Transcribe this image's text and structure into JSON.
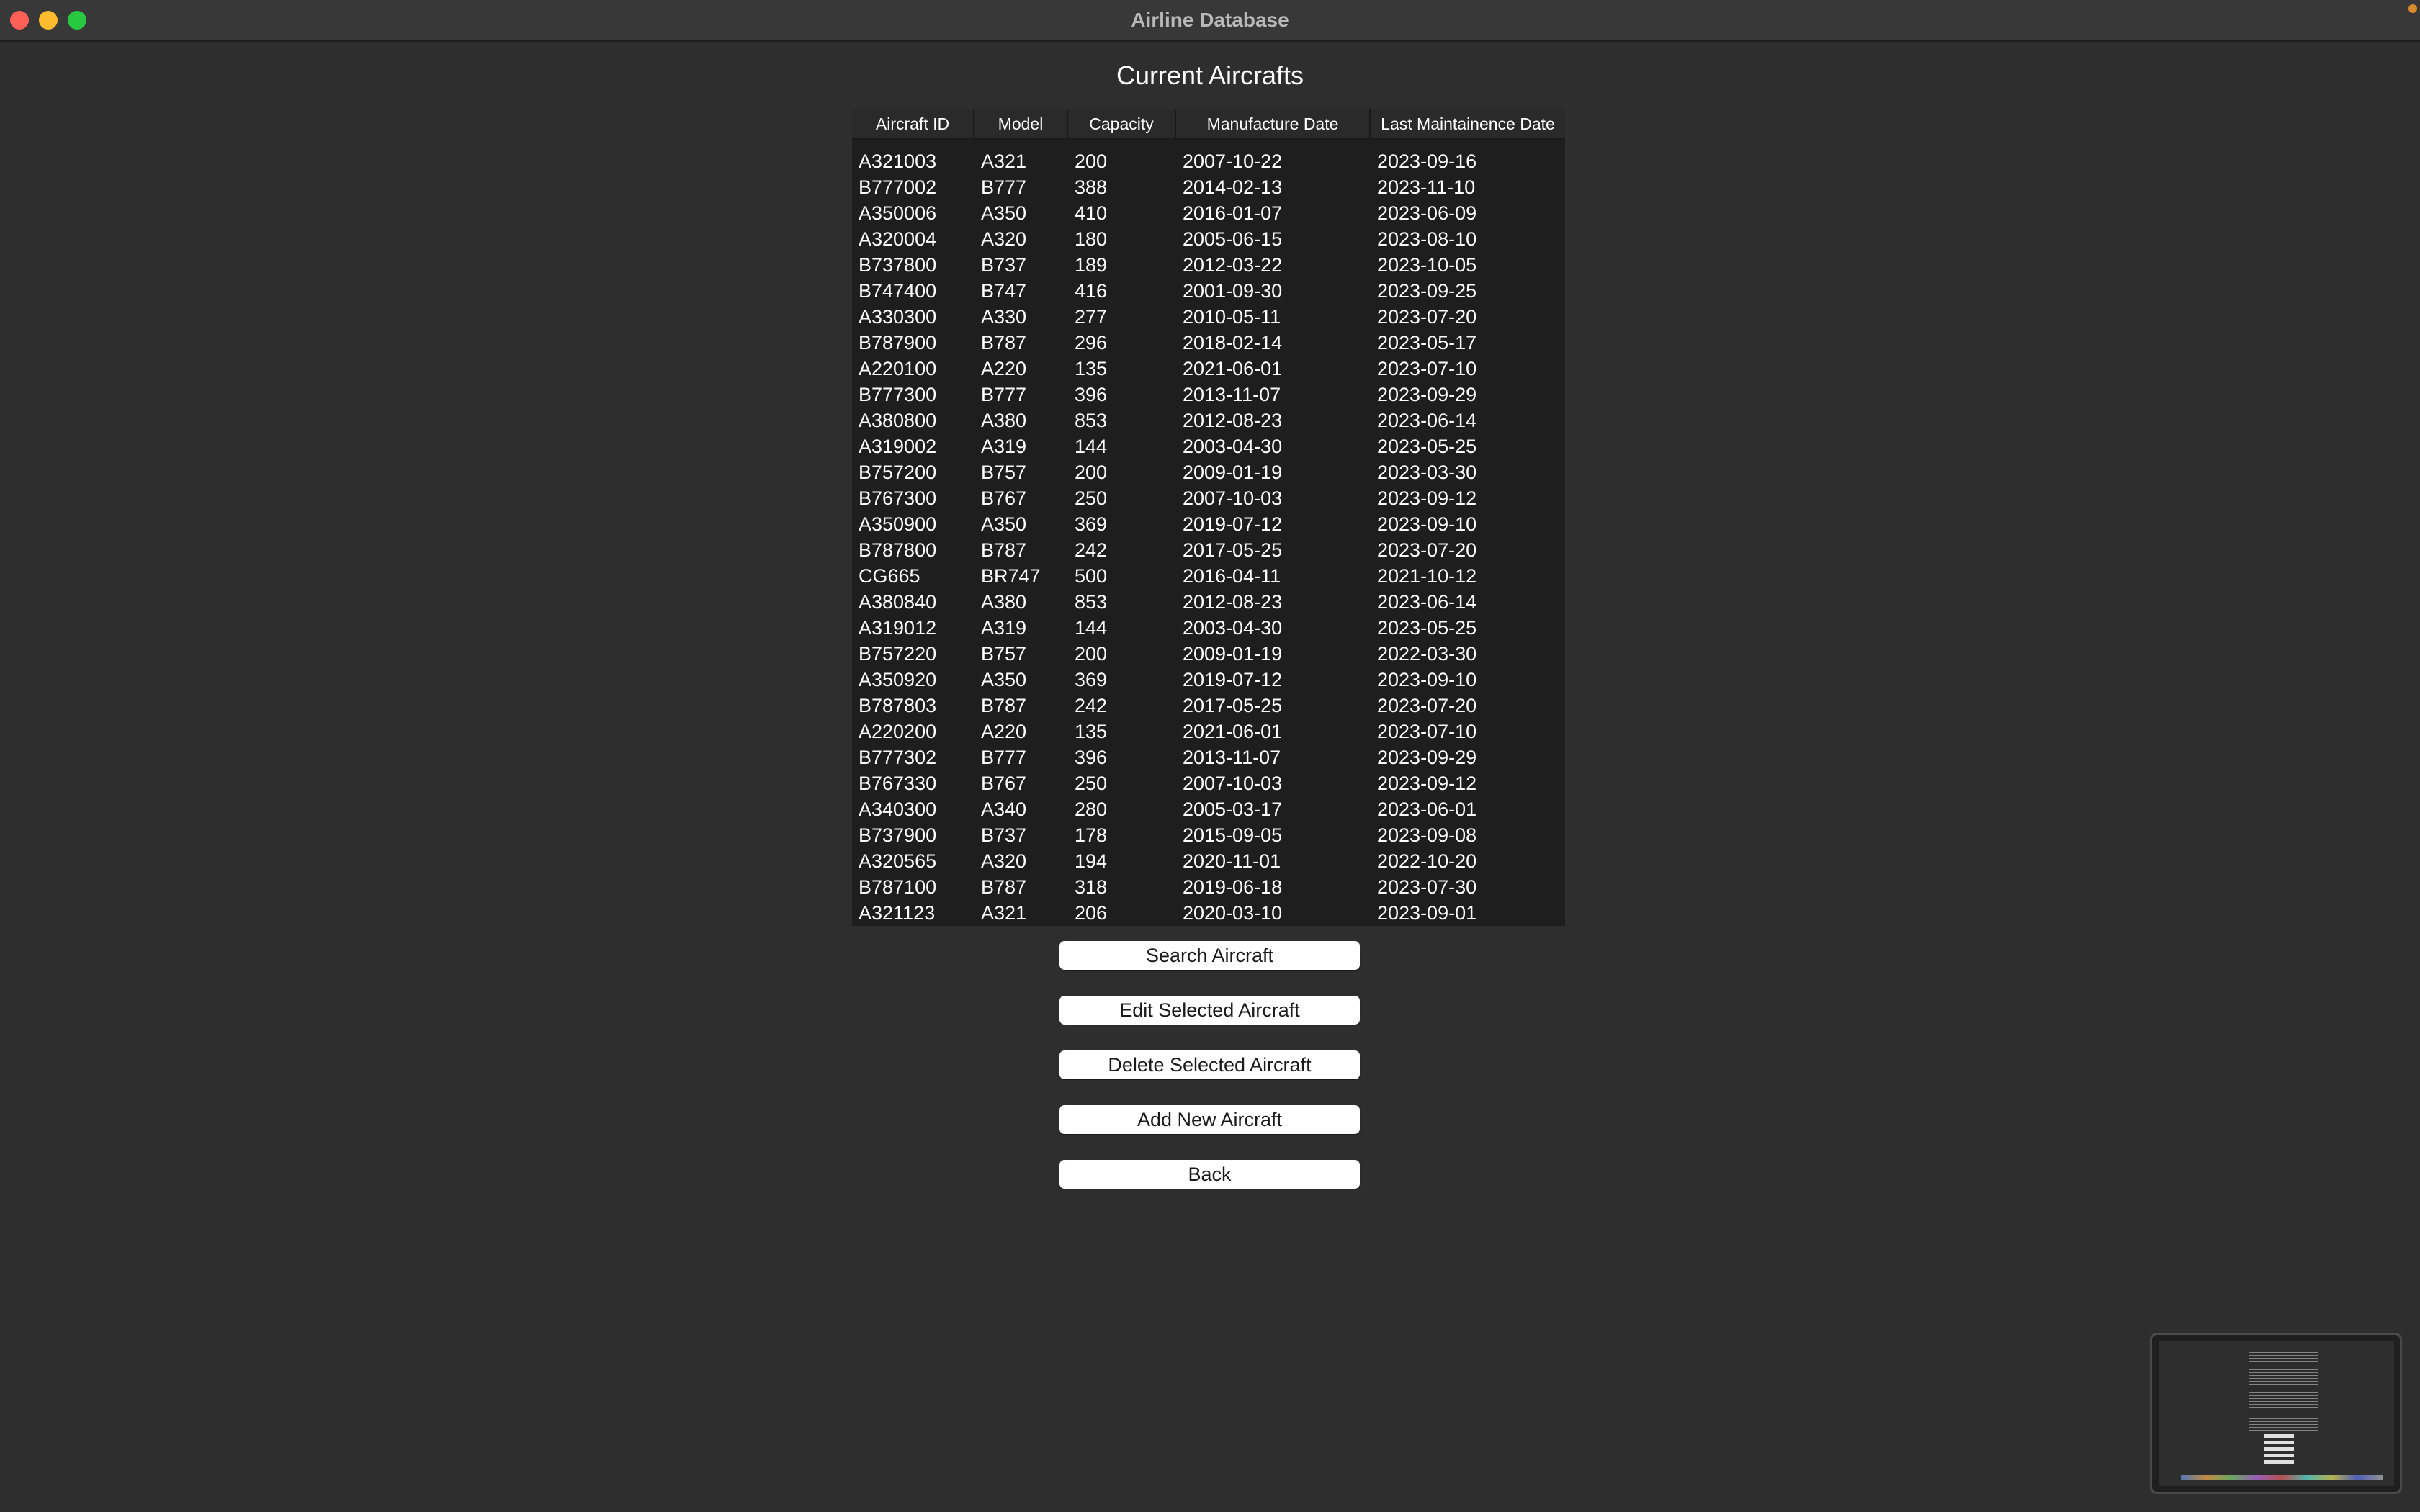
{
  "window": {
    "title": "Airline Database"
  },
  "page": {
    "title": "Current Aircrafts"
  },
  "table": {
    "columns": [
      "Aircraft ID",
      "Model",
      "Capacity",
      "Manufacture Date",
      "Last Maintainence Date"
    ],
    "rows": [
      [
        "A321003",
        "A321",
        "200",
        "2007-10-22",
        "2023-09-16"
      ],
      [
        "B777002",
        "B777",
        "388",
        "2014-02-13",
        "2023-11-10"
      ],
      [
        "A350006",
        "A350",
        "410",
        "2016-01-07",
        "2023-06-09"
      ],
      [
        "A320004",
        "A320",
        "180",
        "2005-06-15",
        "2023-08-10"
      ],
      [
        "B737800",
        "B737",
        "189",
        "2012-03-22",
        "2023-10-05"
      ],
      [
        "B747400",
        "B747",
        "416",
        "2001-09-30",
        "2023-09-25"
      ],
      [
        "A330300",
        "A330",
        "277",
        "2010-05-11",
        "2023-07-20"
      ],
      [
        "B787900",
        "B787",
        "296",
        "2018-02-14",
        "2023-05-17"
      ],
      [
        "A220100",
        "A220",
        "135",
        "2021-06-01",
        "2023-07-10"
      ],
      [
        "B777300",
        "B777",
        "396",
        "2013-11-07",
        "2023-09-29"
      ],
      [
        "A380800",
        "A380",
        "853",
        "2012-08-23",
        "2023-06-14"
      ],
      [
        "A319002",
        "A319",
        "144",
        "2003-04-30",
        "2023-05-25"
      ],
      [
        "B757200",
        "B757",
        "200",
        "2009-01-19",
        "2023-03-30"
      ],
      [
        "B767300",
        "B767",
        "250",
        "2007-10-03",
        "2023-09-12"
      ],
      [
        "A350900",
        "A350",
        "369",
        "2019-07-12",
        "2023-09-10"
      ],
      [
        "B787800",
        "B787",
        "242",
        "2017-05-25",
        "2023-07-20"
      ],
      [
        "CG665",
        "BR747",
        "500",
        "2016-04-11",
        "2021-10-12"
      ],
      [
        "A380840",
        "A380",
        "853",
        "2012-08-23",
        "2023-06-14"
      ],
      [
        "A319012",
        "A319",
        "144",
        "2003-04-30",
        "2023-05-25"
      ],
      [
        "B757220",
        "B757",
        "200",
        "2009-01-19",
        "2022-03-30"
      ],
      [
        "A350920",
        "A350",
        "369",
        "2019-07-12",
        "2023-09-10"
      ],
      [
        "B787803",
        "B787",
        "242",
        "2017-05-25",
        "2023-07-20"
      ],
      [
        "A220200",
        "A220",
        "135",
        "2021-06-01",
        "2023-07-10"
      ],
      [
        "B777302",
        "B777",
        "396",
        "2013-11-07",
        "2023-09-29"
      ],
      [
        "B767330",
        "B767",
        "250",
        "2007-10-03",
        "2023-09-12"
      ],
      [
        "A340300",
        "A340",
        "280",
        "2005-03-17",
        "2023-06-01"
      ],
      [
        "B737900",
        "B737",
        "178",
        "2015-09-05",
        "2023-09-08"
      ],
      [
        "A320565",
        "A320",
        "194",
        "2020-11-01",
        "2022-10-20"
      ],
      [
        "B787100",
        "B787",
        "318",
        "2019-06-18",
        "2023-07-30"
      ],
      [
        "A321123",
        "A321",
        "206",
        "2020-03-10",
        "2023-09-01"
      ]
    ]
  },
  "buttons": {
    "search": "Search Aircraft",
    "edit": "Edit Selected Aircraft",
    "delete": "Delete Selected Aircraft",
    "add": "Add New Aircraft",
    "back": "Back"
  },
  "colors": {
    "background": "#2e2e2e",
    "table_background": "#1e1e1e",
    "button_background": "#ffffff",
    "close": "#fe5f57",
    "minimize": "#febc2e",
    "maximize": "#28c840"
  }
}
